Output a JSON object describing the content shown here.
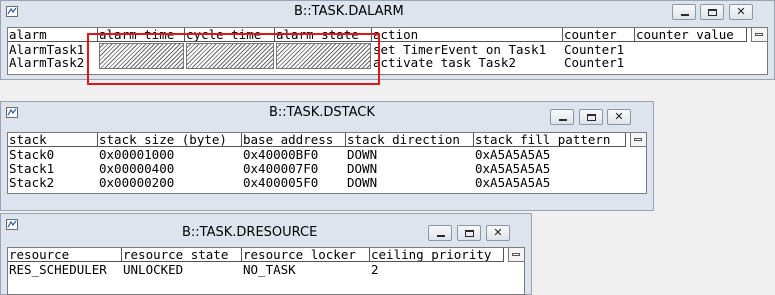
{
  "dalarm": {
    "title": "B::TASK.DALARM",
    "columns": [
      "alarm",
      "alarm time",
      "cycle time",
      "alarm state",
      "action",
      "counter",
      "counter value"
    ],
    "rows": [
      {
        "alarm": "AlarmTask1",
        "action": "set TimerEvent on Task1",
        "counter": "Counter1"
      },
      {
        "alarm": "AlarmTask2",
        "action": "activate task Task2",
        "counter": "Counter1"
      }
    ]
  },
  "dstack": {
    "title": "B::TASK.DSTACK",
    "columns": [
      "stack",
      "stack size (byte)",
      "base address",
      "stack direction",
      "stack fill pattern"
    ],
    "rows": [
      [
        "Stack0",
        "0x00001000",
        "0x40000BF0",
        "DOWN",
        "0xA5A5A5A5"
      ],
      [
        "Stack1",
        "0x00000400",
        "0x400007F0",
        "DOWN",
        "0xA5A5A5A5"
      ],
      [
        "Stack2",
        "0x00000200",
        "0x400005F0",
        "DOWN",
        "0xA5A5A5A5"
      ]
    ]
  },
  "dresource": {
    "title": "B::TASK.DRESOURCE",
    "columns": [
      "resource",
      "resource state",
      "resource locker",
      "ceiling priority"
    ],
    "rows": [
      [
        "RES_SCHEDULER",
        "UNLOCKED",
        "NO_TASK",
        "2"
      ]
    ]
  },
  "window_controls": {
    "close_glyph": "✕"
  },
  "colors": {
    "highlight": "#e0161c",
    "titlebar": "#dde4ee"
  }
}
